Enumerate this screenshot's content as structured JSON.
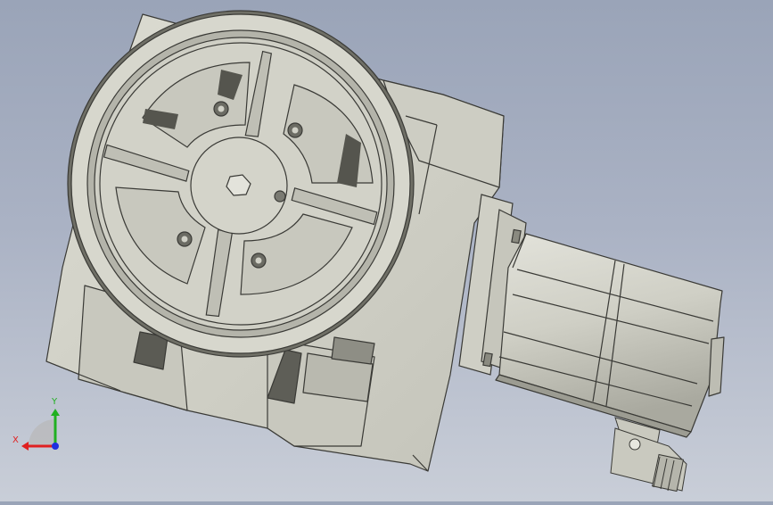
{
  "viewport": {
    "background_top": "#9aa4b8",
    "background_bottom": "#c9ced8",
    "part_color": "#d3d3c9",
    "shadow_color": "#6f6f66"
  },
  "triad": {
    "x_label": "X",
    "y_label": "Y",
    "x_color": "#e02020",
    "y_color": "#20b020",
    "z_color": "#2030e0"
  }
}
